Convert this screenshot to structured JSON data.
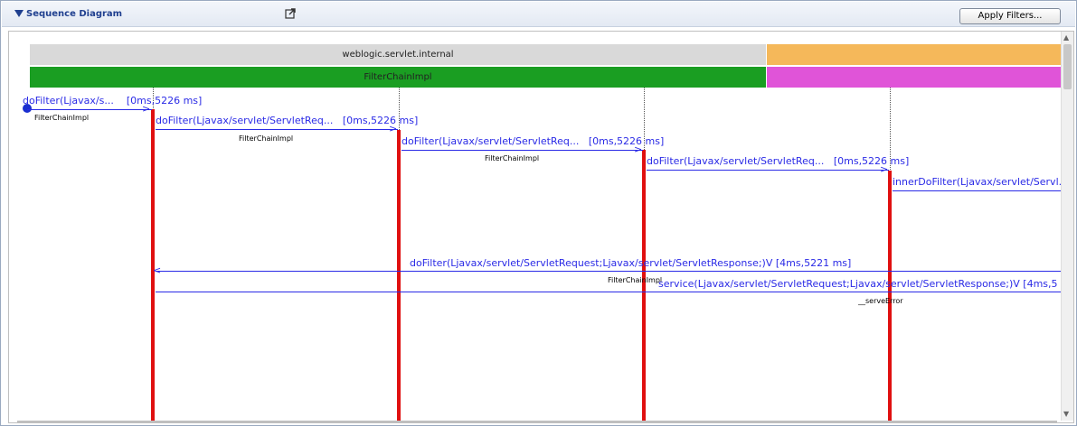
{
  "panel": {
    "title": "Sequence Diagram",
    "apply_filters_label": "Apply Filters..."
  },
  "bands": {
    "package_label": "weblogic.servlet.internal",
    "class_label": "FilterChainImpl",
    "colors": {
      "package": "#d9d9d9",
      "package_right": "#f5b85a",
      "class": "#1a9e22",
      "class_right": "#e054d8"
    }
  },
  "messages": [
    {
      "label": "doFilter(Ljavax/s...",
      "timing": "[0ms,5226 ms]",
      "sub": "FilterChainImpl"
    },
    {
      "label": "doFilter(Ljavax/servlet/ServletReq...",
      "timing": "[0ms,5226 ms]",
      "sub": "FilterChainImpl"
    },
    {
      "label": "doFilter(Ljavax/servlet/ServletReq...",
      "timing": "[0ms,5226 ms]",
      "sub": "FilterChainImpl"
    },
    {
      "label": "doFilter(Ljavax/servlet/ServletReq...",
      "timing": "[0ms,5226 ms]",
      "sub": ""
    },
    {
      "label": "innerDoFilter(Ljavax/servlet/Servl...",
      "timing": "",
      "sub": ""
    }
  ],
  "returns": [
    {
      "label": "doFilter(Ljavax/servlet/ServletRequest;Ljavax/servlet/ServletResponse;)V  [4ms,5221 ms]",
      "sub": "FilterChainImpl"
    },
    {
      "label": "service(Ljavax/servlet/ServletRequest;Ljavax/servlet/ServletResponse;)V  [4ms,5",
      "sub": "__serveError"
    }
  ]
}
